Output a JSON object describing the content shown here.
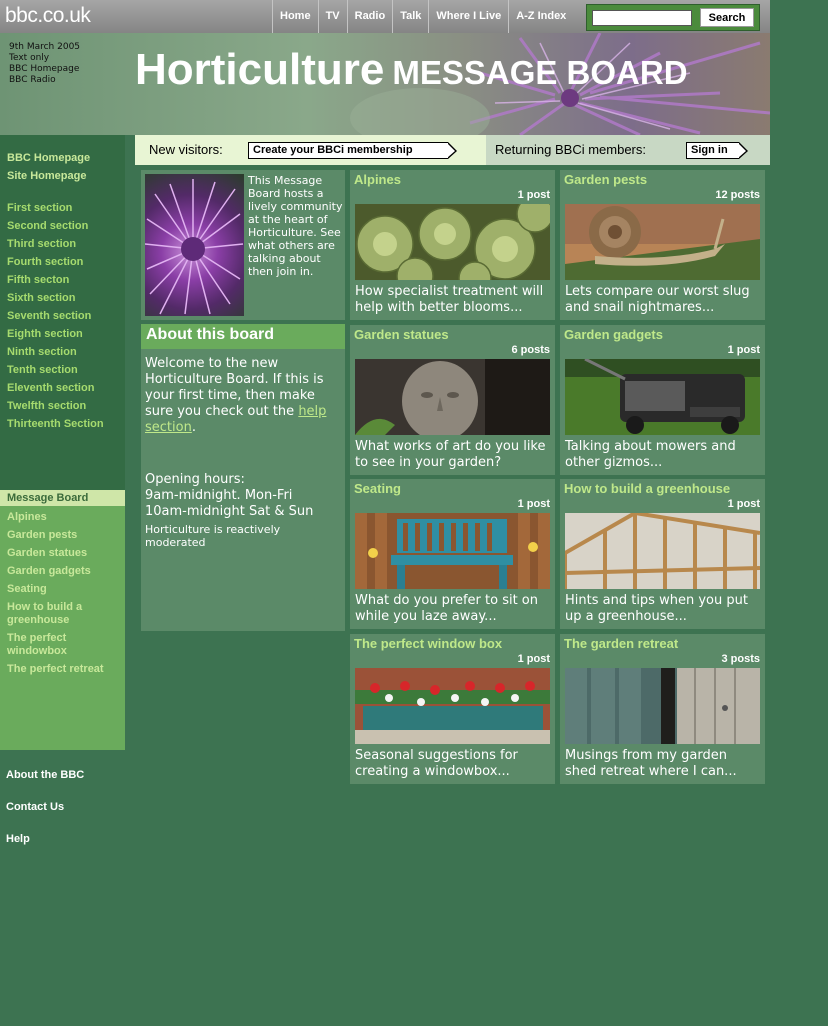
{
  "header": {
    "logo": "bbc.co.uk",
    "nav": [
      "Home",
      "TV",
      "Radio",
      "Talk",
      "Where I Live",
      "A-Z Index"
    ],
    "search_button": "Search",
    "search_value": ""
  },
  "banner": {
    "date": "9th March 2005",
    "links": [
      "Text only",
      "BBC Homepage",
      "BBC Radio"
    ],
    "title": "Horticulture",
    "subtitle": "MESSAGE BOARD"
  },
  "visitors": {
    "new_label": "New visitors:",
    "new_button": "Create your BBCi membership",
    "return_label": "Returning BBCi members:",
    "return_button": "Sign in"
  },
  "sidebar": {
    "top_links": [
      "BBC Homepage",
      "Site Homepage"
    ],
    "sections": [
      "First section",
      "Second section",
      "Third section",
      "Fourth section",
      "Fifth secton",
      "Sixth section",
      "Seventh section",
      "Eighth section",
      "Ninth section",
      "Tenth section",
      "Eleventh section",
      "Twelfth section",
      "Thirteenth Section"
    ],
    "current": "Message Board",
    "board_links": [
      "Alpines",
      "Garden pests",
      "Garden statues",
      "Garden gadgets",
      "Seating",
      "How to build a greenhouse",
      "The perfect windowbox",
      "The perfect retreat"
    ],
    "footer_links": [
      "About the BBC",
      "Contact Us",
      "Help"
    ]
  },
  "intro": {
    "text": "This Message Board hosts a lively community at the heart of Horticulture. See what others are talking about then join in."
  },
  "about": {
    "heading": "About this board",
    "welcome": "Welcome to the new Horticulture Board. If this is your first time, then make sure you check out the",
    "help_link": "help section",
    "welcome_end": ".",
    "hours_label": "Opening hours:",
    "hours_1": "9am-midnight. Mon-Fri",
    "hours_2": "10am-midnight Sat & Sun",
    "moderation": "Horticulture is reactively moderated"
  },
  "topics": [
    {
      "title": "Alpines",
      "count": "1 post",
      "desc": "How specialist treatment will help with better blooms...",
      "image": "alpine-plants-photo"
    },
    {
      "title": "Garden pests",
      "count": "12 posts",
      "desc": "Lets compare our worst slug and snail nightmares...",
      "image": "snail-photo"
    },
    {
      "title": "Garden statues",
      "count": "6 posts",
      "desc": "What works of art do you like to see in your garden?",
      "image": "statue-head-photo"
    },
    {
      "title": "Garden gadgets",
      "count": "1 post",
      "desc": "Talking about mowers and other gizmos...",
      "image": "lawn-mower-photo"
    },
    {
      "title": "Seating",
      "count": "1 post",
      "desc": "What do you prefer to sit on while you laze away...",
      "image": "garden-bench-photo"
    },
    {
      "title": "How to build a greenhouse",
      "count": "1 post",
      "desc": "Hints and tips when you put up a greenhouse...",
      "image": "greenhouse-frame-photo"
    },
    {
      "title": "The perfect window box",
      "count": "1 post",
      "desc": "Seasonal suggestions for creating a windowbox...",
      "image": "window-box-photo"
    },
    {
      "title": "The garden retreat",
      "count": "3 posts",
      "desc": "Musings from my garden shed retreat where I can...",
      "image": "shed-door-photo"
    }
  ]
}
